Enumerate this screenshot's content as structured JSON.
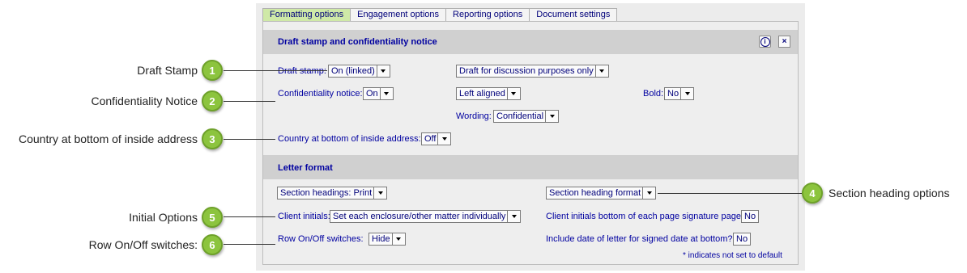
{
  "callouts": {
    "c1": {
      "number": "1",
      "label": "Draft Stamp"
    },
    "c2": {
      "number": "2",
      "label": "Confidentiality Notice"
    },
    "c3": {
      "number": "3",
      "label": "Country at bottom of inside address"
    },
    "c4": {
      "number": "4",
      "label": "Section heading options"
    },
    "c5": {
      "number": "5",
      "label": "Initial Options"
    },
    "c6": {
      "number": "6",
      "label": "Row On/Off switches:"
    }
  },
  "tabs": [
    "Formatting options",
    "Engagement options",
    "Reporting options",
    "Document settings"
  ],
  "draft_section": {
    "title": "Draft stamp and confidentiality notice",
    "info_button": "i",
    "close_button": "×",
    "draft_stamp_label": "Draft stamp:",
    "draft_stamp_value": "On (linked)",
    "draft_text_value": "Draft for discussion purposes only",
    "confidentiality_label": "Confidentiality notice:",
    "confidentiality_value": "On",
    "alignment_value": "Left aligned",
    "bold_label": "Bold:",
    "bold_value": "No",
    "wording_label": "Wording:",
    "wording_value": "Confidential",
    "country_label": "Country at bottom of inside address:",
    "country_value": "Off"
  },
  "letter_section": {
    "title": "Letter format",
    "section_headings_value": "Section headings: Print",
    "section_heading_format_value": "Section heading format",
    "client_initials_label": "Client initials:",
    "client_initials_value": "Set each enclosure/other matter individually",
    "initials_bottom_label": "Client initials bottom of each page signature page:",
    "initials_bottom_value": "No",
    "row_switches_label": "Row On/Off switches:",
    "row_switches_value": "Hide",
    "include_date_label": "Include date of letter for signed date at bottom?",
    "include_date_value": "No",
    "footnote": "* indicates not set to default"
  },
  "colors": {
    "tab_active": "#cfe9a7",
    "badge": "#8cc43e",
    "label_text": "#0000a0"
  }
}
